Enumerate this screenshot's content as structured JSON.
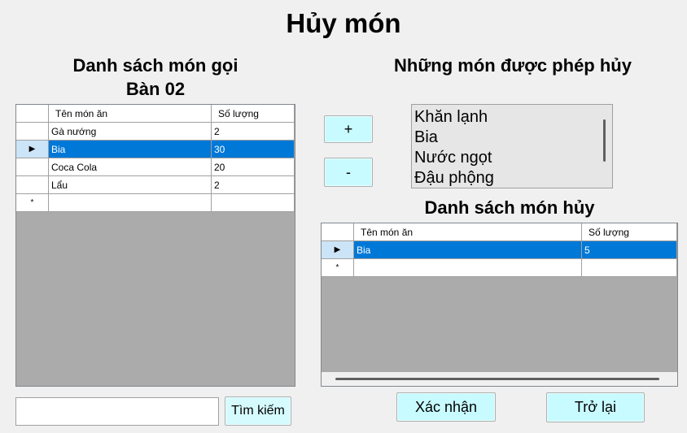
{
  "window": {
    "title": "Hủy món"
  },
  "left_panel": {
    "heading_line1": "Danh sách món gọi",
    "heading_line2": "Bàn 02",
    "grid": {
      "columns": [
        "Tên món ăn",
        "Số lượng"
      ],
      "rows": [
        {
          "name": "Gà nướng",
          "qty": "2"
        },
        {
          "name": "Bia",
          "qty": "30"
        },
        {
          "name": "Coca Cola",
          "qty": "20"
        },
        {
          "name": "Lẩu",
          "qty": "2"
        }
      ],
      "new_row_marker": "*"
    },
    "search_input": {
      "value": ""
    },
    "search_button": "Tìm kiếm"
  },
  "middle": {
    "add_button": "+",
    "remove_button": "-"
  },
  "right_panel": {
    "allowed_heading": "Những món được phép hủy",
    "allowed_items": [
      "Khăn lạnh",
      "Bia",
      "Nước ngọt",
      "Đậu phộng"
    ],
    "cancel_heading": "Danh sách món hủy",
    "grid": {
      "columns": [
        "Tên món ăn",
        "Số lượng"
      ],
      "rows": [
        {
          "name": "Bia",
          "qty": "5"
        }
      ],
      "new_row_marker": "*"
    },
    "confirm_button": "Xác nhận",
    "back_button": "Trở lại"
  }
}
